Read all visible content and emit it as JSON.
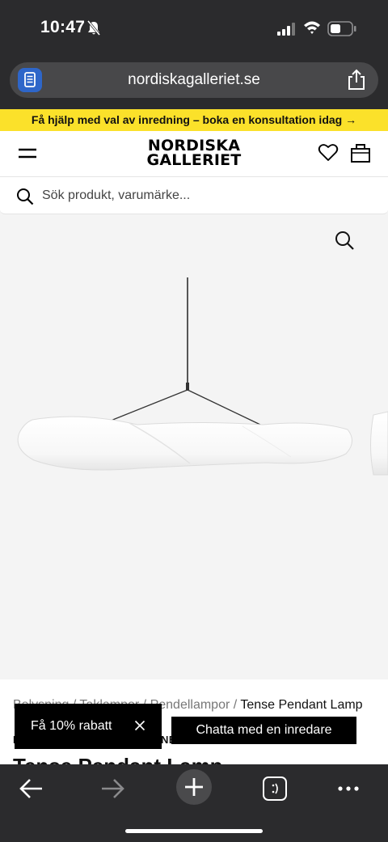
{
  "status_bar": {
    "time": "10:47"
  },
  "browser": {
    "url": "nordiskagalleriet.se"
  },
  "promo": {
    "text": "Få hjälp med val av inredning – boka en konsultation idag →"
  },
  "header": {
    "logo_line1": "NORDISKA",
    "logo_line2": "GALLERIET"
  },
  "search": {
    "placeholder": "Sök produkt, varumärke..."
  },
  "breadcrumb": {
    "items": [
      "Belysning",
      "Taklampor",
      "Pendellampor"
    ],
    "separator": " / ",
    "current": "Tense Pendant Lamp"
  },
  "product": {
    "brand_prefix": "F",
    "brand_suffix": "NE",
    "title": "Tense Pendant Lamp"
  },
  "popups": {
    "discount_label": "Få 10% rabatt",
    "chat_label": "Chatta med en inredare"
  },
  "colors": {
    "promo_yellow": "#fbe12a",
    "chrome_dark": "#2b2b2d",
    "reader_blue": "#2e66c9"
  },
  "icons": [
    "bell-slash-icon",
    "signal-icon",
    "wifi-icon",
    "battery-icon",
    "reader-icon",
    "share-icon",
    "menu-icon",
    "heart-icon",
    "bag-icon",
    "search-icon",
    "zoom-icon",
    "close-icon",
    "back-arrow-icon",
    "forward-arrow-icon",
    "plus-icon",
    "tabs-icon",
    "more-icon"
  ]
}
